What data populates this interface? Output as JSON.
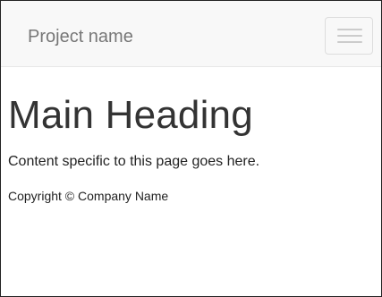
{
  "navbar": {
    "brand": "Project name",
    "toggle_icon": "hamburger-icon"
  },
  "main": {
    "heading": "Main Heading",
    "content": "Content specific to this page goes here."
  },
  "footer": {
    "copyright": "Copyright © Company Name"
  }
}
